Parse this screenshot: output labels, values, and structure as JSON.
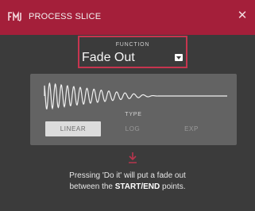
{
  "window": {
    "title": "PROCESS SLICE"
  },
  "function": {
    "label": "FUNCTION",
    "value": "Fade Out"
  },
  "type": {
    "label": "TYPE",
    "options": [
      {
        "label": "LINEAR",
        "selected": true
      },
      {
        "label": "LOG",
        "selected": false
      },
      {
        "label": "EXP",
        "selected": false
      }
    ]
  },
  "info": {
    "line1": "Pressing 'Do it' will put a fade out",
    "line2_prefix": "between the ",
    "line2_emphasis": "START/END",
    "line2_suffix": " points."
  },
  "colors": {
    "titlebar": "#a41f3a",
    "background": "#3b3b3b",
    "accent_border": "#c7354f",
    "panel": "#636363",
    "arrow": "#b8364e"
  },
  "icons": [
    "akai-logo-icon",
    "close-icon",
    "chevron-down-icon",
    "download-arrow-icon"
  ]
}
